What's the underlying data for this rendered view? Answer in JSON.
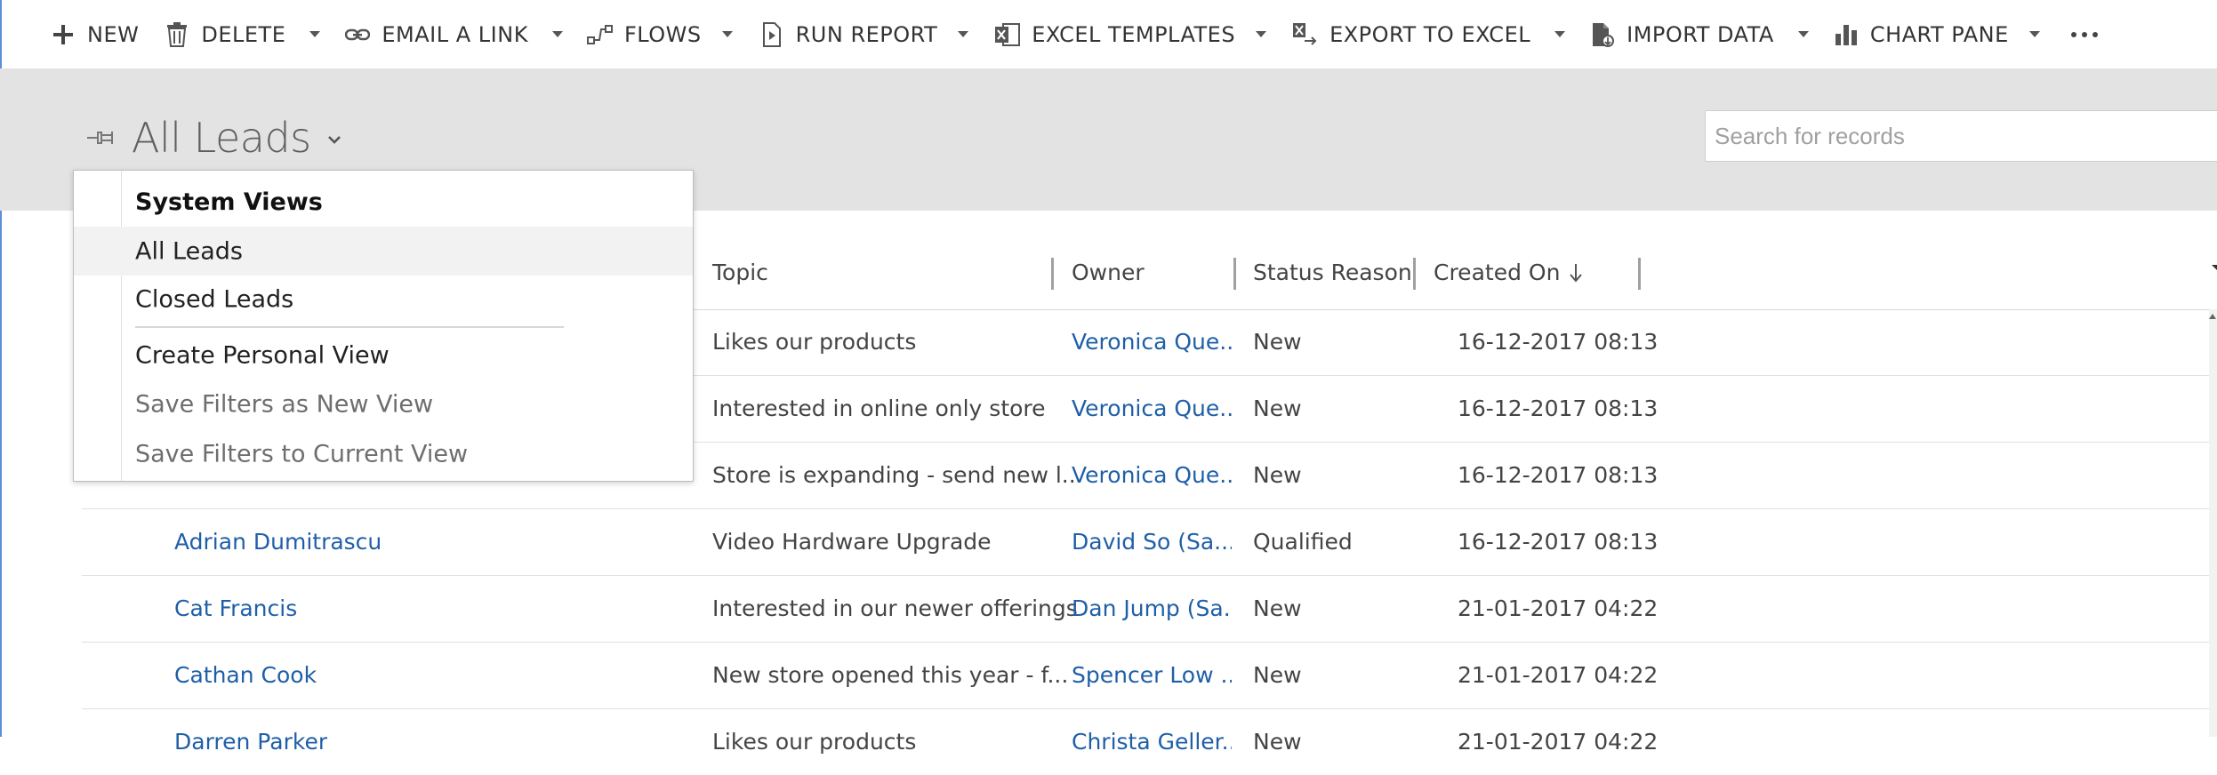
{
  "toolbar": {
    "new": "NEW",
    "delete": "DELETE",
    "email": "EMAIL A LINK",
    "flows": "FLOWS",
    "run_report": "RUN REPORT",
    "excel_templates": "EXCEL TEMPLATES",
    "export": "EXPORT TO EXCEL",
    "import": "IMPORT DATA",
    "chart_pane": "CHART PANE"
  },
  "view": {
    "title": "All Leads"
  },
  "search": {
    "placeholder": "Search for records"
  },
  "columns": {
    "topic": "Topic",
    "owner": "Owner",
    "status": "Status Reason",
    "created": "Created On"
  },
  "rows": [
    {
      "name": "",
      "topic": "Likes our products",
      "owner": "Veronica Que...",
      "status": "New",
      "created": "16-12-2017 08:13"
    },
    {
      "name": "",
      "topic": "Interested in online only store",
      "owner": "Veronica Que...",
      "status": "New",
      "created": "16-12-2017 08:13"
    },
    {
      "name": "",
      "topic": "Store is expanding - send new l...",
      "owner": "Veronica Que...",
      "status": "New",
      "created": "16-12-2017 08:13"
    },
    {
      "name": "Adrian Dumitrascu",
      "topic": "Video Hardware Upgrade",
      "owner": "David So (Sa...",
      "status": "Qualified",
      "created": "16-12-2017 08:13"
    },
    {
      "name": "Cat Francis",
      "topic": "Interested in our newer offerings",
      "owner": "Dan Jump (Sa...",
      "status": "New",
      "created": "21-01-2017 04:22"
    },
    {
      "name": "Cathan Cook",
      "topic": "New store opened this year - f...",
      "owner": "Spencer Low ...",
      "status": "New",
      "created": "21-01-2017 04:22"
    },
    {
      "name": "Darren Parker",
      "topic": "Likes our products",
      "owner": "Christa Geller...",
      "status": "New",
      "created": "21-01-2017 04:22"
    }
  ],
  "menu": {
    "header": "System Views",
    "all_leads": "All Leads",
    "closed_leads": "Closed Leads",
    "create_personal": "Create Personal View",
    "save_new": "Save Filters as New View",
    "save_current": "Save Filters to Current View"
  },
  "colors": {
    "link": "#1f5fa8",
    "band": "#e3e3e3"
  }
}
